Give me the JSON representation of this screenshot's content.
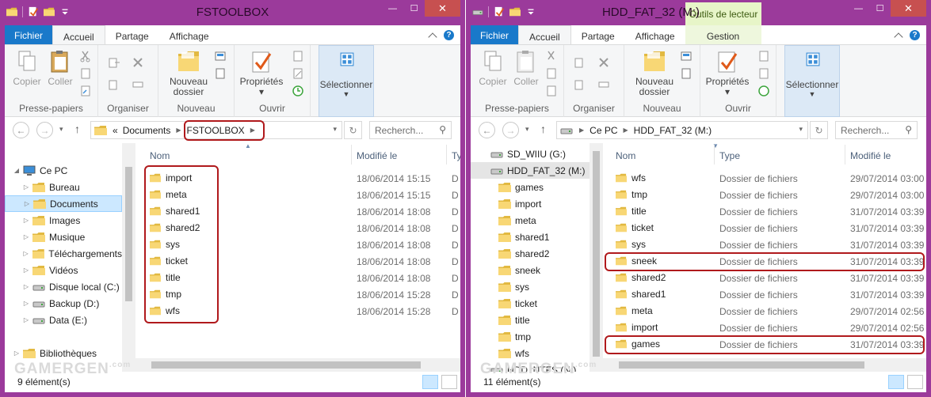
{
  "common": {
    "ribbon_groups": {
      "clipboard": "Presse-papiers",
      "organize": "Organiser",
      "new": "Nouveau",
      "open": "Ouvrir"
    },
    "buttons": {
      "copy": "Copier",
      "paste": "Coller",
      "new_folder_1": "Nouveau",
      "new_folder_2": "dossier",
      "properties": "Propriétés",
      "select": "Sélectionner"
    },
    "col_name": "Nom",
    "col_modified": "Modifié le",
    "col_type": "Type",
    "search_placeholder": "Recherch...",
    "watermark": "GAMERGEN",
    "watermark_suffix": ".com"
  },
  "left": {
    "title": "FSTOOLBOX",
    "tabs": {
      "file": "Fichier",
      "home": "Accueil",
      "share": "Partage",
      "view": "Affichage"
    },
    "address": {
      "sep": "«",
      "parent": "Documents",
      "current": "FSTOOLBOX"
    },
    "col_type_cut": "Ty",
    "tree": [
      {
        "label": "Ce PC",
        "icon": "computer-icon"
      },
      {
        "label": "Bureau",
        "icon": "desktop-folder-icon"
      },
      {
        "label": "Documents",
        "icon": "documents-folder-icon"
      },
      {
        "label": "Images",
        "icon": "pictures-folder-icon"
      },
      {
        "label": "Musique",
        "icon": "music-folder-icon"
      },
      {
        "label": "Téléchargements",
        "icon": "downloads-folder-icon"
      },
      {
        "label": "Vidéos",
        "icon": "videos-folder-icon"
      },
      {
        "label": "Disque local (C:)",
        "icon": "system-drive-icon"
      },
      {
        "label": "Backup (D:)",
        "icon": "drive-icon"
      },
      {
        "label": "Data (E:)",
        "icon": "drive-icon"
      },
      {
        "label": "Bibliothèques",
        "icon": "libraries-icon"
      }
    ],
    "files": [
      {
        "name": "import",
        "date": "18/06/2014 15:15",
        "t": "D"
      },
      {
        "name": "meta",
        "date": "18/06/2014 15:15",
        "t": "D"
      },
      {
        "name": "shared1",
        "date": "18/06/2014 18:08",
        "t": "D"
      },
      {
        "name": "shared2",
        "date": "18/06/2014 18:08",
        "t": "D"
      },
      {
        "name": "sys",
        "date": "18/06/2014 18:08",
        "t": "D"
      },
      {
        "name": "ticket",
        "date": "18/06/2014 18:08",
        "t": "D"
      },
      {
        "name": "title",
        "date": "18/06/2014 18:08",
        "t": "D"
      },
      {
        "name": "tmp",
        "date": "18/06/2014 15:28",
        "t": "D"
      },
      {
        "name": "wfs",
        "date": "18/06/2014 15:28",
        "t": "D"
      }
    ],
    "status": "9 élément(s)"
  },
  "right": {
    "title": "HDD_FAT_32 (M:)",
    "context_tab": "Outils de lecteur",
    "tabs": {
      "file": "Fichier",
      "home": "Accueil",
      "share": "Partage",
      "view": "Affichage",
      "manage": "Gestion"
    },
    "address": {
      "pc": "Ce PC",
      "current": "HDD_FAT_32 (M:)"
    },
    "tree": [
      {
        "label": "SD_WIIU (G:)",
        "icon": "removable-drive-icon",
        "level": 0
      },
      {
        "label": "HDD_FAT_32 (M:)",
        "icon": "drive-icon",
        "level": 0
      },
      {
        "label": "games",
        "icon": "folder-icon",
        "level": 1
      },
      {
        "label": "import",
        "icon": "folder-icon",
        "level": 1
      },
      {
        "label": "meta",
        "icon": "folder-icon",
        "level": 1
      },
      {
        "label": "shared1",
        "icon": "folder-icon",
        "level": 1
      },
      {
        "label": "shared2",
        "icon": "folder-icon",
        "level": 1
      },
      {
        "label": "sneek",
        "icon": "folder-icon",
        "level": 1
      },
      {
        "label": "sys",
        "icon": "folder-icon",
        "level": 1
      },
      {
        "label": "ticket",
        "icon": "folder-icon",
        "level": 1
      },
      {
        "label": "title",
        "icon": "folder-icon",
        "level": 1
      },
      {
        "label": "tmp",
        "icon": "folder-icon",
        "level": 1
      },
      {
        "label": "wfs",
        "icon": "folder-icon",
        "level": 1
      },
      {
        "label": "HDD_NTFS (N:)",
        "icon": "drive-icon",
        "level": 0
      }
    ],
    "files": [
      {
        "name": "wfs",
        "type": "Dossier de fichiers",
        "date": "29/07/2014 03:00"
      },
      {
        "name": "tmp",
        "type": "Dossier de fichiers",
        "date": "29/07/2014 03:00"
      },
      {
        "name": "title",
        "type": "Dossier de fichiers",
        "date": "31/07/2014 03:39"
      },
      {
        "name": "ticket",
        "type": "Dossier de fichiers",
        "date": "31/07/2014 03:39"
      },
      {
        "name": "sys",
        "type": "Dossier de fichiers",
        "date": "31/07/2014 03:39"
      },
      {
        "name": "sneek",
        "type": "Dossier de fichiers",
        "date": "31/07/2014 03:39"
      },
      {
        "name": "shared2",
        "type": "Dossier de fichiers",
        "date": "31/07/2014 03:39"
      },
      {
        "name": "shared1",
        "type": "Dossier de fichiers",
        "date": "31/07/2014 03:39"
      },
      {
        "name": "meta",
        "type": "Dossier de fichiers",
        "date": "29/07/2014 02:56"
      },
      {
        "name": "import",
        "type": "Dossier de fichiers",
        "date": "29/07/2014 02:56"
      },
      {
        "name": "games",
        "type": "Dossier de fichiers",
        "date": "31/07/2014 03:39"
      }
    ],
    "status": "11 élément(s)"
  },
  "colors": {
    "frame": "#9b3a9b",
    "file_tab": "#1979ca",
    "highlight": "#b0191c",
    "selection": "#cce8ff",
    "close": "#c75050"
  }
}
